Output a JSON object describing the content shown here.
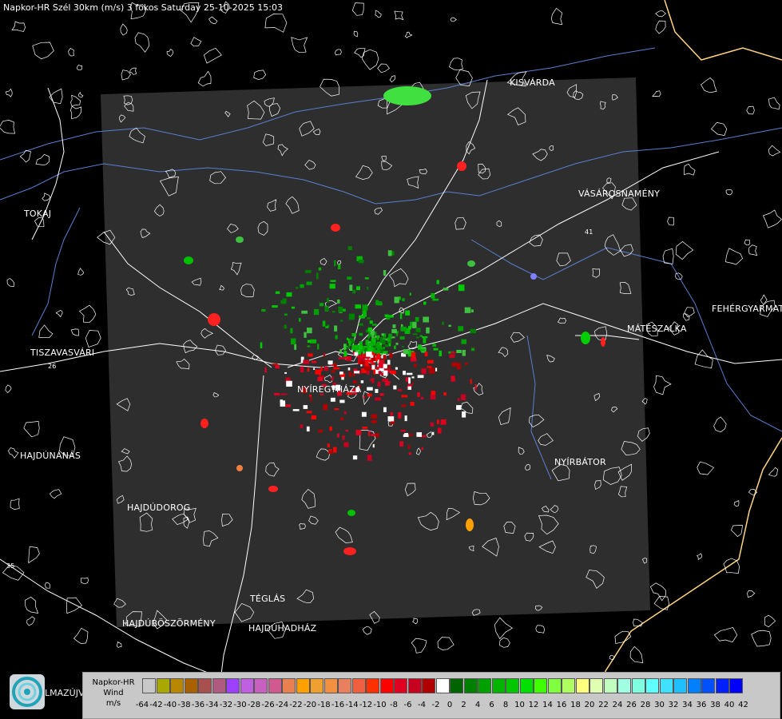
{
  "title": "Napkor-HR Szél 30km (m/s) 3 fokos Saturday 25-10-2025 15:03",
  "cities": [
    {
      "name": "KISVÁRDA"
    },
    {
      "name": "VÁSÁROSNAMÉNY"
    },
    {
      "name": "TOKAJ"
    },
    {
      "name": "TISZAVASVÁRI"
    },
    {
      "name": "FEHÉRGYARMAT"
    },
    {
      "name": "MÁTÉSZALKA"
    },
    {
      "name": "NYÍREGYHÁZA"
    },
    {
      "name": "NYÍRBÁTOR"
    },
    {
      "name": "HAJDÚNÁNÁS"
    },
    {
      "name": "HAJDÚDOROG"
    },
    {
      "name": "TÉGLÁS"
    },
    {
      "name": "HAJDÚBÖSZÖRMÉNY"
    },
    {
      "name": "HAJDÚHADHÁZ"
    }
  ],
  "road_numbers": [
    "26",
    "35",
    "41"
  ],
  "logo_text": "LMAZÚJVÁR",
  "legend": {
    "title_lines": [
      "Napkor-HR",
      "Wind",
      "m/s"
    ],
    "labels": [
      "-64",
      "-42",
      "-40",
      "-38",
      "-36",
      "-34",
      "-32",
      "-30",
      "-28",
      "-26",
      "-24",
      "-22",
      "-20",
      "-18",
      "-16",
      "-14",
      "-12",
      "-10",
      "-8",
      "-6",
      "-4",
      "-2",
      "0",
      "2",
      "4",
      "6",
      "8",
      "10",
      "12",
      "14",
      "16",
      "18",
      "20",
      "22",
      "24",
      "26",
      "28",
      "30",
      "32",
      "34",
      "36",
      "38",
      "40",
      "42"
    ],
    "colors": [
      "#c8c8c8",
      "#a8a800",
      "#b88800",
      "#a86000",
      "#a85050",
      "#b05a80",
      "#a040ff",
      "#c060e0",
      "#c860c0",
      "#d05a90",
      "#e88050",
      "#ffa000",
      "#f0a030",
      "#f09040",
      "#e88060",
      "#f06040",
      "#ff3000",
      "#ff0000",
      "#e00020",
      "#c80020",
      "#b00000",
      "#ffffff",
      "#006400",
      "#008000",
      "#00a000",
      "#00b400",
      "#00c800",
      "#00e000",
      "#40ff00",
      "#80ff40",
      "#b0ff60",
      "#ffff80",
      "#e0ffb0",
      "#c0ffc0",
      "#a0ffe0",
      "#80ffe0",
      "#60ffff",
      "#40e0ff",
      "#20c0ff",
      "#0080ff",
      "#0050ff",
      "#0020ff",
      "#0000ff"
    ],
    "colors_note": "41 swatches between labels"
  },
  "colors": {
    "radar_area": "#2e2e2e",
    "rivers": "#5a7fd0",
    "border": "#ffd480",
    "roads": "#ffffff"
  }
}
